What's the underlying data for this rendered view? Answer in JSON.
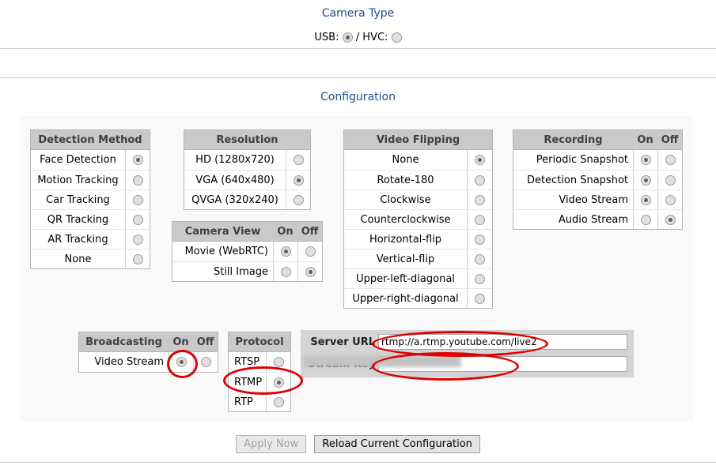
{
  "camera_type": {
    "title": "Camera Type",
    "usb_label": "USB:",
    "separator": "/",
    "hvc_label": "HVC:",
    "usb_selected": true,
    "hvc_selected": false
  },
  "configuration": {
    "title": "Configuration"
  },
  "detection_method": {
    "header": "Detection Method",
    "items": [
      {
        "label": "Face Detection",
        "selected": true
      },
      {
        "label": "Motion Tracking",
        "selected": false
      },
      {
        "label": "Car Tracking",
        "selected": false
      },
      {
        "label": "QR Tracking",
        "selected": false
      },
      {
        "label": "AR Tracking",
        "selected": false
      },
      {
        "label": "None",
        "selected": false
      }
    ]
  },
  "resolution": {
    "header": "Resolution",
    "items": [
      {
        "label": "HD (1280x720)",
        "selected": false
      },
      {
        "label": "VGA (640x480)",
        "selected": true
      },
      {
        "label": "QVGA (320x240)",
        "selected": false
      }
    ]
  },
  "camera_view": {
    "header": "Camera View",
    "on_label": "On",
    "off_label": "Off",
    "items": [
      {
        "label": "Movie (WebRTC)",
        "on": true,
        "off": false
      },
      {
        "label": "Still Image",
        "on": false,
        "off": true
      }
    ]
  },
  "video_flipping": {
    "header": "Video Flipping",
    "items": [
      {
        "label": "None",
        "selected": true
      },
      {
        "label": "Rotate-180",
        "selected": false
      },
      {
        "label": "Clockwise",
        "selected": false
      },
      {
        "label": "Counterclockwise",
        "selected": false
      },
      {
        "label": "Horizontal-flip",
        "selected": false
      },
      {
        "label": "Vertical-flip",
        "selected": false
      },
      {
        "label": "Upper-left-diagonal",
        "selected": false
      },
      {
        "label": "Upper-right-diagonal",
        "selected": false
      }
    ]
  },
  "recording": {
    "header": "Recording",
    "on_label": "On",
    "off_label": "Off",
    "items": [
      {
        "label": "Periodic Snapshot",
        "on": true,
        "off": false
      },
      {
        "label": "Detection Snapshot",
        "on": true,
        "off": false
      },
      {
        "label": "Video Stream",
        "on": true,
        "off": false
      },
      {
        "label": "Audio Stream",
        "on": false,
        "off": true
      }
    ]
  },
  "broadcasting": {
    "header": "Broadcasting",
    "on_label": "On",
    "off_label": "Off",
    "items": [
      {
        "label": "Video Stream",
        "on": true,
        "off": false
      }
    ]
  },
  "protocol": {
    "header": "Protocol",
    "items": [
      {
        "label": "RTSP",
        "selected": false
      },
      {
        "label": "RTMP",
        "selected": true
      },
      {
        "label": "RTP",
        "selected": false
      }
    ]
  },
  "broadcast_detail": {
    "server_url_label": "Server URL",
    "server_url_value": "rtmp://a.rtmp.youtube.com/live2",
    "stream_key_label": "Stream Key",
    "stream_key_value": ""
  },
  "buttons": {
    "apply_now": "Apply Now",
    "apply_now_disabled": true,
    "reload": "Reload Current Configuration"
  },
  "colors": {
    "title_blue": "#1a4f93",
    "header_gray": "#c9c9c9",
    "panel_bg": "#f9f9f9",
    "annotation_red": "#e00000",
    "detail_bg": "#d4d4d4"
  }
}
